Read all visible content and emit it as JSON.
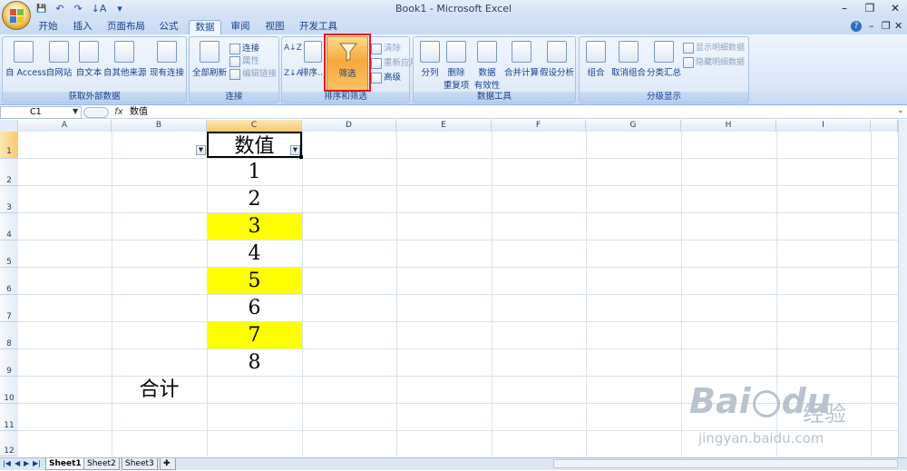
{
  "window": {
    "title": "Book1 - Microsoft Excel"
  },
  "qat": {
    "save": "💾",
    "undo": "↶",
    "redo": "↷",
    "sort": "↓A",
    "more": "▾"
  },
  "tabs": [
    "开始",
    "插入",
    "页面布局",
    "公式",
    "数据",
    "审阅",
    "视图",
    "开发工具"
  ],
  "active_tab": "数据",
  "ribbon": {
    "groups": {
      "external": "获取外部数据",
      "connections": "连接",
      "sort_filter": "排序和筛选",
      "data_tools": "数据工具",
      "outline": "分级显示"
    },
    "external": {
      "access": "自 Access",
      "web": "自网站",
      "text": "自文本",
      "other": "自其他来源",
      "existing": "现有连接"
    },
    "connections": {
      "refresh": "全部刷新",
      "connect": "连接",
      "properties": "属性",
      "edit_links": "编辑链接"
    },
    "sort_filter": {
      "sort": "排序...",
      "filter": "筛选",
      "clear": "清除",
      "reapply": "重新应用",
      "advanced": "高级"
    },
    "data_tools": {
      "split": "分列",
      "dedupe": "删除",
      "dedupe2": "重复项",
      "validate": "数据",
      "validate2": "有效性",
      "consolidate": "合并计算",
      "whatif": "假设分析"
    },
    "outline": {
      "group": "组合",
      "ungroup": "取消组合",
      "subtotal": "分类汇总",
      "show_detail": "显示明细数据",
      "hide_detail": "隐藏明细数据"
    }
  },
  "formula": {
    "name_box": "C1",
    "fx": "fx",
    "value": "数值"
  },
  "columns": [
    "A",
    "B",
    "C",
    "D",
    "E",
    "F",
    "G",
    "H",
    "I"
  ],
  "rows": [
    "1",
    "2",
    "3",
    "4",
    "5",
    "6",
    "7",
    "8",
    "9",
    "10",
    "11",
    "12"
  ],
  "cells": {
    "C1": "数值",
    "C2": "1",
    "C3": "2",
    "C4": "3",
    "C5": "4",
    "C6": "5",
    "C7": "6",
    "C8": "7",
    "C9": "8",
    "B10": "合计"
  },
  "highlight_color": "#ffff00",
  "sheets": [
    "Sheet1",
    "Sheet2",
    "Sheet3"
  ],
  "watermark": {
    "brand": "Bai",
    "brand2": "du",
    "cn": "经验",
    "url": "jingyan.baidu.com"
  }
}
